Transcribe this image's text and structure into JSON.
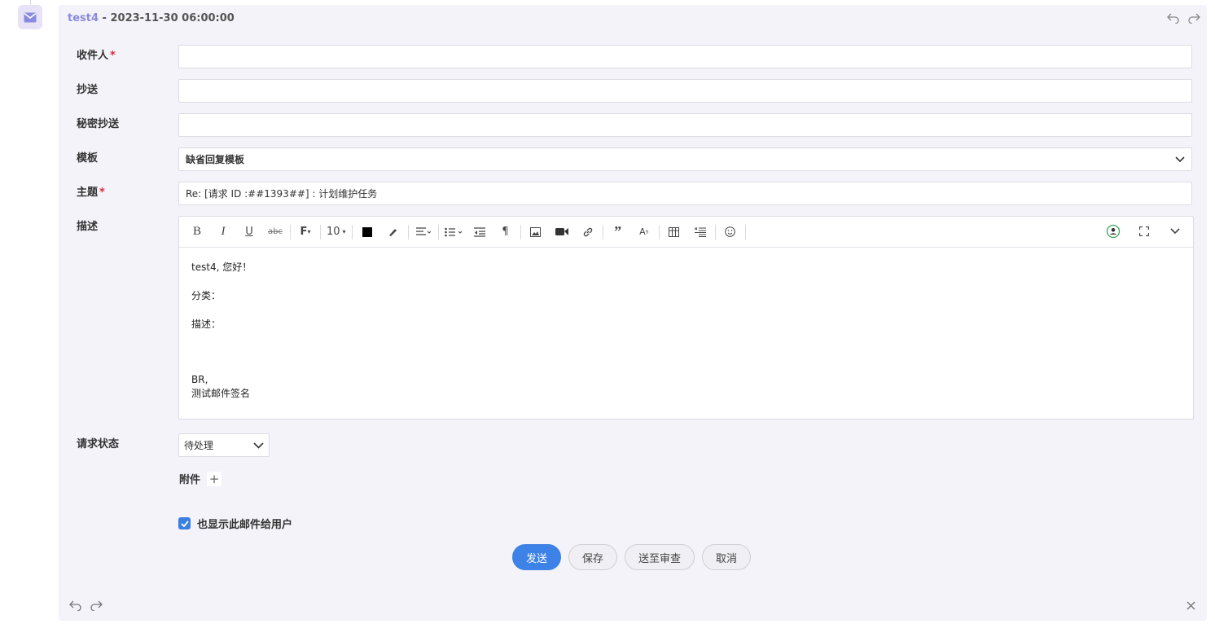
{
  "header": {
    "sender": "test4",
    "separator": " - ",
    "datetime": "2023-11-30 06:00:00"
  },
  "labels": {
    "to": "收件人",
    "cc": "抄送",
    "bcc": "秘密抄送",
    "template": "模板",
    "subject": "主题",
    "description": "描述",
    "status": "请求状态",
    "attachments": "附件"
  },
  "required_mark": "*",
  "fields": {
    "to": "",
    "cc": "",
    "bcc": "",
    "template": "缺省回复模板",
    "subject": "Re: [请求 ID :##1393##] : 计划维护任务"
  },
  "toolbar": {
    "font_size": "10"
  },
  "editor": {
    "greeting": "test4, 您好！",
    "category": "分类：",
    "description": "描述：",
    "sign_br": "BR,",
    "signature": "测试邮件签名"
  },
  "status": {
    "value": "待处理"
  },
  "show_to_user": {
    "label": "也显示此邮件给用户",
    "checked": true
  },
  "buttons": {
    "send": "发送",
    "save": "保存",
    "submit_review": "送至审查",
    "cancel": "取消"
  },
  "colors": {
    "accent": "#3d82e6",
    "sender": "#8a8adf",
    "required": "#e0283c",
    "panel": "#f3f3f9"
  }
}
